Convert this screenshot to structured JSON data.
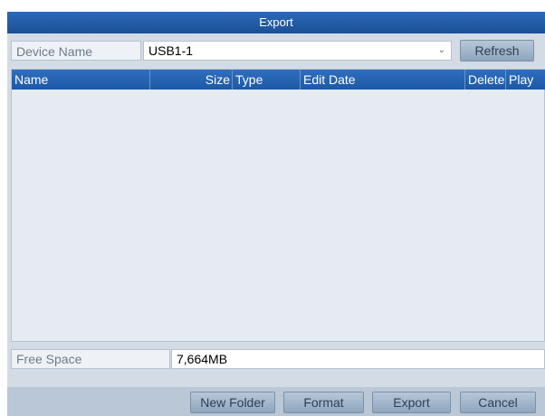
{
  "dialog": {
    "title": "Export"
  },
  "device": {
    "label": "Device Name",
    "selected": "USB1-1",
    "refresh_label": "Refresh"
  },
  "table": {
    "columns": {
      "name": "Name",
      "size": "Size",
      "type": "Type",
      "edit_date": "Edit Date",
      "delete": "Delete",
      "play": "Play"
    },
    "rows": []
  },
  "storage": {
    "free_label": "Free Space",
    "free_value": "7,664MB"
  },
  "footer": {
    "new_folder_label": "New Folder",
    "format_label": "Format",
    "export_label": "Export",
    "cancel_label": "Cancel"
  },
  "colors": {
    "title_bar": "#1b4f95",
    "header": "#2f6fbf",
    "panel_bg": "#d3dbe5",
    "button": "#8fa6be"
  }
}
